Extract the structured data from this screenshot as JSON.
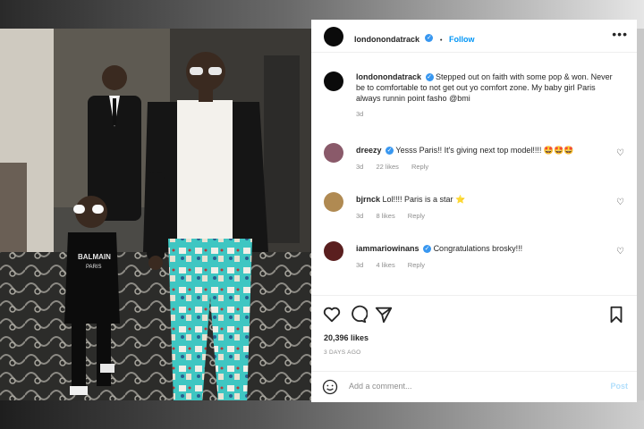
{
  "post": {
    "username": "londonondatrack",
    "follow_label": "Follow",
    "separator": "•",
    "more_label": "•••",
    "caption_text": "Stepped out on faith with some pop & won. Never be to comfortable to not get out yo comfort zone. My baby girl Paris always runnin point fasho @bmi",
    "caption_age": "3d",
    "likes": "20,396 likes",
    "date": "3 DAYS AGO",
    "photo_shirt_text": "BALMAIN\nPARIS"
  },
  "comments": [
    {
      "username": "dreezy",
      "text": "Yesss Paris!! It's giving next top model!!!! 🤩🤩🤩",
      "age": "3d",
      "likes": "22 likes",
      "reply": "Reply",
      "avatar_color": "#8a5a6a"
    },
    {
      "username": "bjrnck",
      "text": "Lol!!!! Paris is a star ⭐",
      "age": "3d",
      "likes": "8 likes",
      "reply": "Reply",
      "avatar_color": "#b08a52"
    },
    {
      "username": "iammariowinans",
      "text": "Congratulations brosky!!!",
      "age": "3d",
      "likes": "4 likes",
      "reply": "Reply",
      "avatar_color": "#5a1f1f"
    }
  ],
  "actions": {
    "like_icon": "heart-icon",
    "comment_icon": "comment-icon",
    "share_icon": "share-icon",
    "save_icon": "bookmark-icon"
  },
  "add_comment": {
    "emoji_icon": "smiley-icon",
    "placeholder": "Add a comment...",
    "post_label": "Post"
  }
}
